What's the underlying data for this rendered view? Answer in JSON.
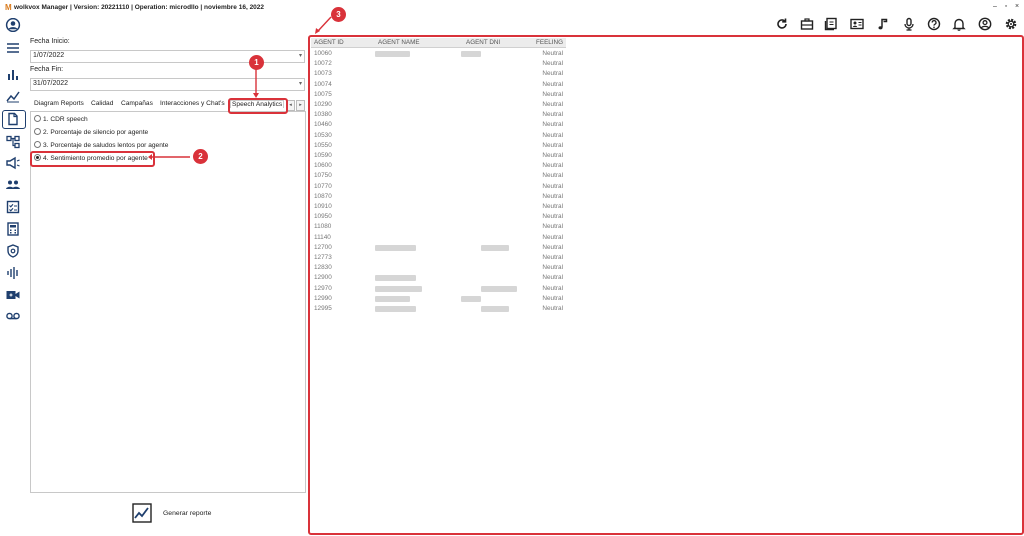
{
  "titlebar": {
    "logo": "M",
    "title": "wolkvox Manager  | Version: 20221110 |  Operation: microdllo | noviembre 16, 2022",
    "minimize": "–",
    "restore": "▫",
    "close": "×"
  },
  "form": {
    "fecha_inicio_label": "Fecha Inicio:",
    "fecha_inicio_value": "1/07/2022",
    "fecha_fin_label": "Fecha Fin:",
    "fecha_fin_value": "31/07/2022"
  },
  "tabs": [
    "Diagram Reports",
    "Calidad",
    "Campañas",
    "Interacciones y Chat's",
    "Speech Analytics"
  ],
  "tab_nav": {
    "prev": "◂",
    "next": "▸"
  },
  "options": [
    {
      "label": "1. CDR speech",
      "selected": false
    },
    {
      "label": "2. Porcentaje de silencio por agente",
      "selected": false
    },
    {
      "label": "3. Porcentaje de saludos lentos por agente",
      "selected": false
    },
    {
      "label": "4. Sentimiento promedio por agente",
      "selected": true
    }
  ],
  "generate": {
    "label": "Generar reporte"
  },
  "grid": {
    "headers": [
      "AGENT ID",
      "AGENT NAME",
      "AGENT DNI",
      "FEELING"
    ],
    "rows": [
      {
        "id": "10060",
        "feeling": "Neutral",
        "name_blur": 1,
        "dni_blur": 1
      },
      {
        "id": "10072",
        "feeling": "Neutral",
        "name_blur": 0,
        "dni_blur": 0
      },
      {
        "id": "10073",
        "feeling": "Neutral",
        "name_blur": 0,
        "dni_blur": 0
      },
      {
        "id": "10074",
        "feeling": "Neutral",
        "name_blur": 0,
        "dni_blur": 0
      },
      {
        "id": "10075",
        "feeling": "Neutral",
        "name_blur": 0,
        "dni_blur": 0
      },
      {
        "id": "10290",
        "feeling": "Neutral",
        "name_blur": 0,
        "dni_blur": 0
      },
      {
        "id": "10380",
        "feeling": "Neutral",
        "name_blur": 0,
        "dni_blur": 0
      },
      {
        "id": "10460",
        "feeling": "Neutral",
        "name_blur": 0,
        "dni_blur": 0
      },
      {
        "id": "10530",
        "feeling": "Neutral",
        "name_blur": 0,
        "dni_blur": 0
      },
      {
        "id": "10550",
        "feeling": "Neutral",
        "name_blur": 0,
        "dni_blur": 0
      },
      {
        "id": "10590",
        "feeling": "Neutral",
        "name_blur": 0,
        "dni_blur": 0
      },
      {
        "id": "10600",
        "feeling": "Neutral",
        "name_blur": 0,
        "dni_blur": 0
      },
      {
        "id": "10750",
        "feeling": "Neutral",
        "name_blur": 0,
        "dni_blur": 0
      },
      {
        "id": "10770",
        "feeling": "Neutral",
        "name_blur": 0,
        "dni_blur": 0
      },
      {
        "id": "10870",
        "feeling": "Neutral",
        "name_blur": 0,
        "dni_blur": 0
      },
      {
        "id": "10910",
        "feeling": "Neutral",
        "name_blur": 0,
        "dni_blur": 0
      },
      {
        "id": "10950",
        "feeling": "Neutral",
        "name_blur": 0,
        "dni_blur": 0
      },
      {
        "id": "11080",
        "feeling": "Neutral",
        "name_blur": 0,
        "dni_blur": 0
      },
      {
        "id": "11140",
        "feeling": "Neutral",
        "name_blur": 0,
        "dni_blur": 0
      },
      {
        "id": "12700",
        "feeling": "Neutral",
        "name_blur": 1,
        "dni_blur": 1
      },
      {
        "id": "12773",
        "feeling": "Neutral",
        "name_blur": 0,
        "dni_blur": 0
      },
      {
        "id": "12830",
        "feeling": "Neutral",
        "name_blur": 0,
        "dni_blur": 0
      },
      {
        "id": "12900",
        "feeling": "Neutral",
        "name_blur": 1,
        "dni_blur": 0
      },
      {
        "id": "12970",
        "feeling": "Neutral",
        "name_blur": 1,
        "dni_blur": 1
      },
      {
        "id": "12990",
        "feeling": "Neutral",
        "name_blur": 1,
        "dni_blur": 1
      },
      {
        "id": "12995",
        "feeling": "Neutral",
        "name_blur": 1,
        "dni_blur": 1
      }
    ]
  },
  "callouts": [
    "1",
    "2",
    "3"
  ],
  "toolbar_icons": [
    "refresh-icon",
    "briefcase-icon",
    "book-icon",
    "contact-card-icon",
    "music-note-icon",
    "microphone-icon",
    "help-icon",
    "bell-icon",
    "user-circle-icon",
    "settings-icon"
  ],
  "sidebar_icons": [
    "avatar-icon",
    "menu-icon",
    "bar-chart-icon",
    "analytics-icon",
    "reports-icon",
    "diagram-icon",
    "campaign-icon",
    "users-icon",
    "checklist-icon",
    "calculator-icon",
    "security-icon",
    "audio-wave-icon",
    "video-call-icon",
    "voicemail-icon"
  ],
  "colors": {
    "accent": "#d9323a",
    "nav_dark": "#1f3f6e"
  }
}
